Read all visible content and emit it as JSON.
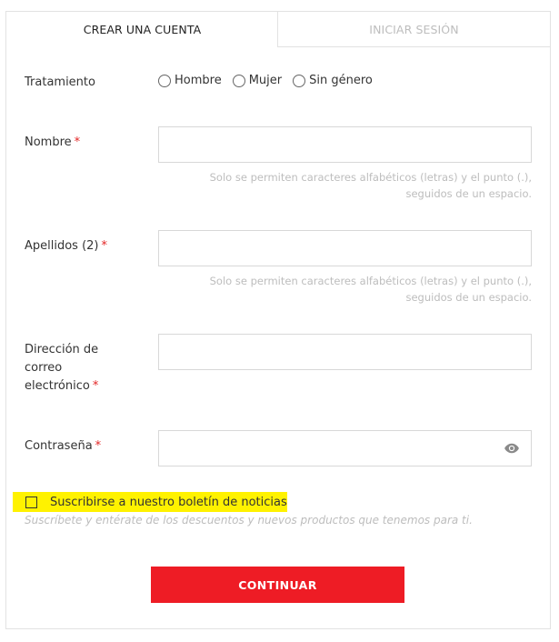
{
  "tabs": {
    "create_account": "CREAR UNA CUENTA",
    "sign_in": "INICIAR SESIÓN"
  },
  "form": {
    "title_label": "Tratamiento",
    "title_options": [
      "Hombre",
      "Mujer",
      "Sin género"
    ],
    "first_name": {
      "label": "Nombre",
      "required_mark": "*",
      "value": "",
      "hint": "Solo se permiten caracteres alfabéticos (letras) y el punto (.), seguidos de un espacio."
    },
    "last_name": {
      "label": "Apellidos (2)",
      "required_mark": "*",
      "value": "",
      "hint": "Solo se permiten caracteres alfabéticos (letras) y el punto (.), seguidos de un espacio."
    },
    "email": {
      "label": "Dirección de correo electrónico",
      "required_mark": "*",
      "value": ""
    },
    "password": {
      "label": "Contraseña",
      "required_mark": "*",
      "value": "",
      "toggle_icon": "eye-icon"
    },
    "newsletter": {
      "label": "Suscribirse a nuestro boletín de noticias",
      "hint": "Suscríbete y entérate de los descuentos y nuevos productos que tenemos para ti.",
      "checked": false,
      "highlight_color": "#fff200"
    },
    "submit_label": "CONTINUAR"
  },
  "colors": {
    "accent": "#ee1c25",
    "required": "#e32626",
    "muted_text": "#bdbdbd"
  }
}
